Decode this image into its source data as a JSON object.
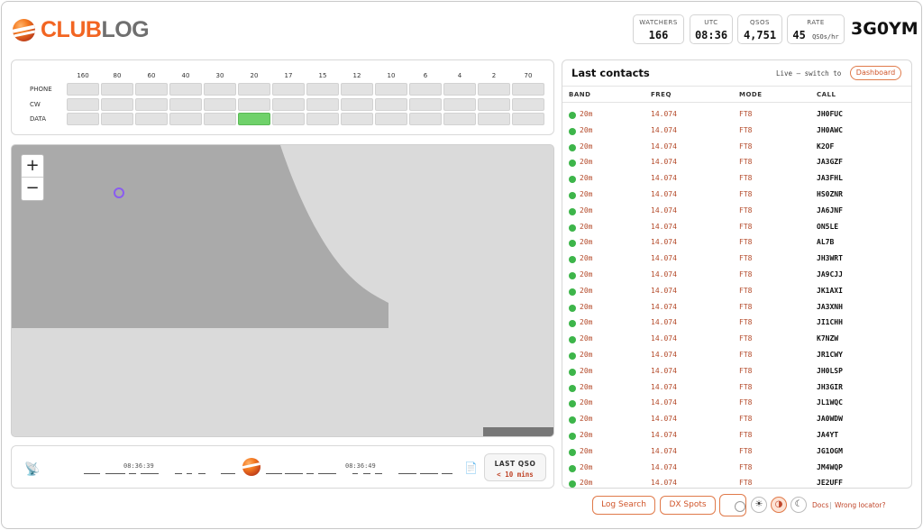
{
  "brand": {
    "club": "CLUB",
    "log": "LOG"
  },
  "stats": [
    {
      "label": "WATCHERS",
      "value": "166",
      "unit": ""
    },
    {
      "label": "UTC",
      "value": "08:36",
      "unit": ""
    },
    {
      "label": "QSOS",
      "value": "4,751",
      "unit": ""
    },
    {
      "label": "RATE",
      "value": "45",
      "unit": "QSOs/hr"
    }
  ],
  "callsign": "3G0YM",
  "bands": [
    "160",
    "80",
    "60",
    "40",
    "30",
    "20",
    "17",
    "15",
    "12",
    "10",
    "6",
    "4",
    "2",
    "70"
  ],
  "modes": [
    "PHONE",
    "CW",
    "DATA"
  ],
  "active_band_cells": [
    {
      "mode": "DATA",
      "band": "20"
    }
  ],
  "map": {
    "zoom_in": "+",
    "zoom_out": "−"
  },
  "timeline": {
    "time_left": "08:36:39",
    "time_right": "08:36:49",
    "last_qso_label": "LAST QSO",
    "last_qso_value": "< 10 mins"
  },
  "contacts": {
    "title": "Last contacts",
    "live_text": "Live — switch to",
    "dashboard_button": "Dashboard",
    "columns": [
      "BAND",
      "FREQ",
      "MODE",
      "CALL"
    ],
    "rows": [
      {
        "band": "20m",
        "freq": "14.074",
        "mode": "FT8",
        "call": "JH0FUC"
      },
      {
        "band": "20m",
        "freq": "14.074",
        "mode": "FT8",
        "call": "JH0AWC"
      },
      {
        "band": "20m",
        "freq": "14.074",
        "mode": "FT8",
        "call": "K2OF"
      },
      {
        "band": "20m",
        "freq": "14.074",
        "mode": "FT8",
        "call": "JA3GZF"
      },
      {
        "band": "20m",
        "freq": "14.074",
        "mode": "FT8",
        "call": "JA3FHL"
      },
      {
        "band": "20m",
        "freq": "14.074",
        "mode": "FT8",
        "call": "HS0ZNR"
      },
      {
        "band": "20m",
        "freq": "14.074",
        "mode": "FT8",
        "call": "JA6JNF"
      },
      {
        "band": "20m",
        "freq": "14.074",
        "mode": "FT8",
        "call": "ON5LE"
      },
      {
        "band": "20m",
        "freq": "14.074",
        "mode": "FT8",
        "call": "AL7B"
      },
      {
        "band": "20m",
        "freq": "14.074",
        "mode": "FT8",
        "call": "JH3WRT"
      },
      {
        "band": "20m",
        "freq": "14.074",
        "mode": "FT8",
        "call": "JA9CJJ"
      },
      {
        "band": "20m",
        "freq": "14.074",
        "mode": "FT8",
        "call": "JK1AXI"
      },
      {
        "band": "20m",
        "freq": "14.074",
        "mode": "FT8",
        "call": "JA3XNH"
      },
      {
        "band": "20m",
        "freq": "14.074",
        "mode": "FT8",
        "call": "JI1CHH"
      },
      {
        "band": "20m",
        "freq": "14.074",
        "mode": "FT8",
        "call": "K7NZW"
      },
      {
        "band": "20m",
        "freq": "14.074",
        "mode": "FT8",
        "call": "JR1CWY"
      },
      {
        "band": "20m",
        "freq": "14.074",
        "mode": "FT8",
        "call": "JH0LSP"
      },
      {
        "band": "20m",
        "freq": "14.074",
        "mode": "FT8",
        "call": "JH3GIR"
      },
      {
        "band": "20m",
        "freq": "14.074",
        "mode": "FT8",
        "call": "JL1WQC"
      },
      {
        "band": "20m",
        "freq": "14.074",
        "mode": "FT8",
        "call": "JA0WDW"
      },
      {
        "band": "20m",
        "freq": "14.074",
        "mode": "FT8",
        "call": "JA4YT"
      },
      {
        "band": "20m",
        "freq": "14.074",
        "mode": "FT8",
        "call": "JG1OGM"
      },
      {
        "band": "20m",
        "freq": "14.074",
        "mode": "FT8",
        "call": "JM4WQP"
      },
      {
        "band": "20m",
        "freq": "14.074",
        "mode": "FT8",
        "call": "JE2UFF"
      }
    ]
  },
  "footer": {
    "log_search": "Log Search",
    "dx_spots": "DX Spots",
    "theme_light_icon": "sun-icon",
    "theme_auto_icon": "contrast-icon",
    "theme_dark_icon": "moon-icon",
    "docs": "Docs",
    "separator": "|",
    "wrong_locator": "Wrong locator?"
  },
  "colors": {
    "accent": "#f26522",
    "active_cell": "#6fd16a",
    "status_dot": "#3db54a"
  }
}
